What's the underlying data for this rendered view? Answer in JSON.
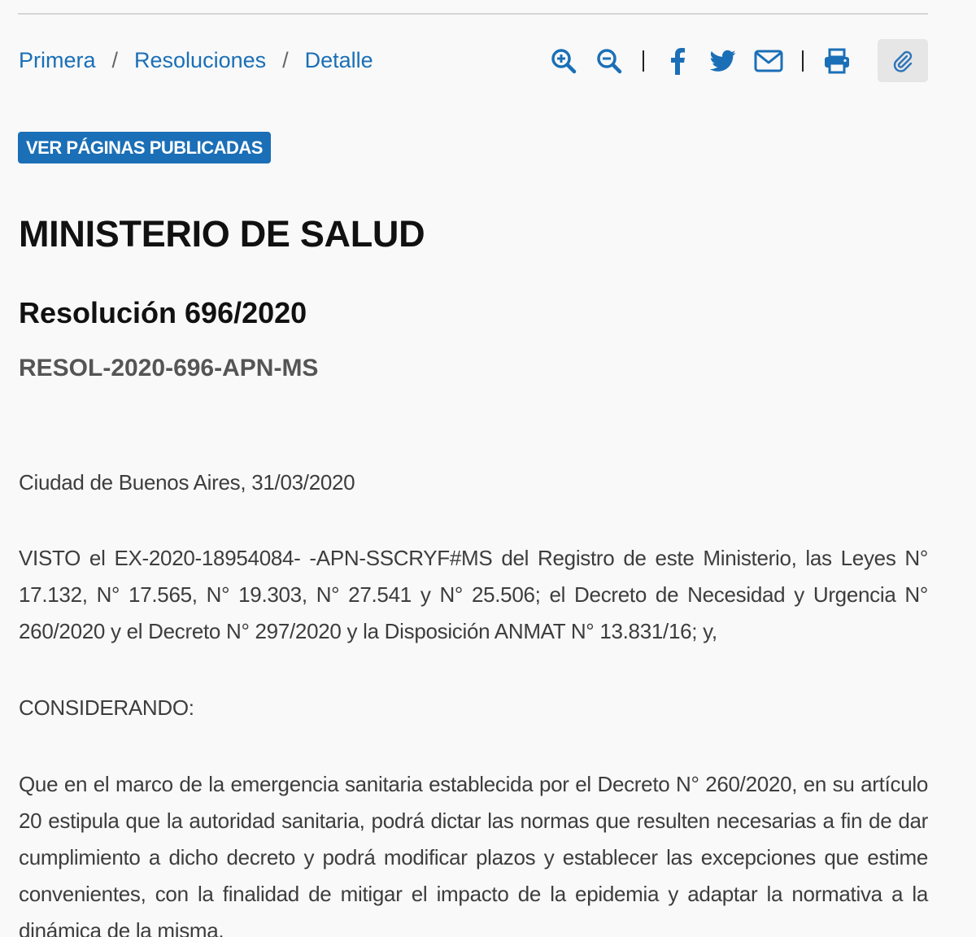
{
  "breadcrumb": {
    "items": [
      "Primera",
      "Resoluciones",
      "Detalle"
    ],
    "separator": "/"
  },
  "toolbar": {
    "icons": [
      "zoom-in-icon",
      "zoom-out-icon",
      "facebook-icon",
      "twitter-icon",
      "mail-icon",
      "print-icon",
      "paperclip-icon"
    ]
  },
  "colors": {
    "accent": "#1a6fb7",
    "background": "#f9f9f9",
    "attach_button_bg": "#e6e6e6"
  },
  "badge": {
    "label": "VER PÁGINAS PUBLICADAS"
  },
  "document": {
    "organismo": "MINISTERIO DE SALUD",
    "titulo": "Resolución 696/2020",
    "codigo": "RESOL-2020-696-APN-MS",
    "fecha": "Ciudad de Buenos Aires, 31/03/2020",
    "visto": "VISTO el EX-2020-18954084- -APN-SSCRYF#MS del Registro de este Ministerio, las Leyes N° 17.132, N° 17.565, N° 19.303, N° 27.541 y N° 25.506; el Decreto de Necesidad y Urgencia N° 260/2020 y el Decreto N° 297/2020 y la Disposición ANMAT N° 13.831/16; y,",
    "considerando": "CONSIDERANDO:",
    "parrafo_1": "Que en el marco de la emergencia sanitaria establecida por el Decreto N° 260/2020, en su artículo 20 estipula que la autoridad sanitaria, podrá dictar las normas que resulten necesarias a fin de dar cumplimiento a dicho decreto y podrá modificar plazos y establecer las excepciones que estime convenientes, con la finalidad de mitigar el impacto de la epidemia y adaptar la normativa a la dinámica de la misma."
  }
}
